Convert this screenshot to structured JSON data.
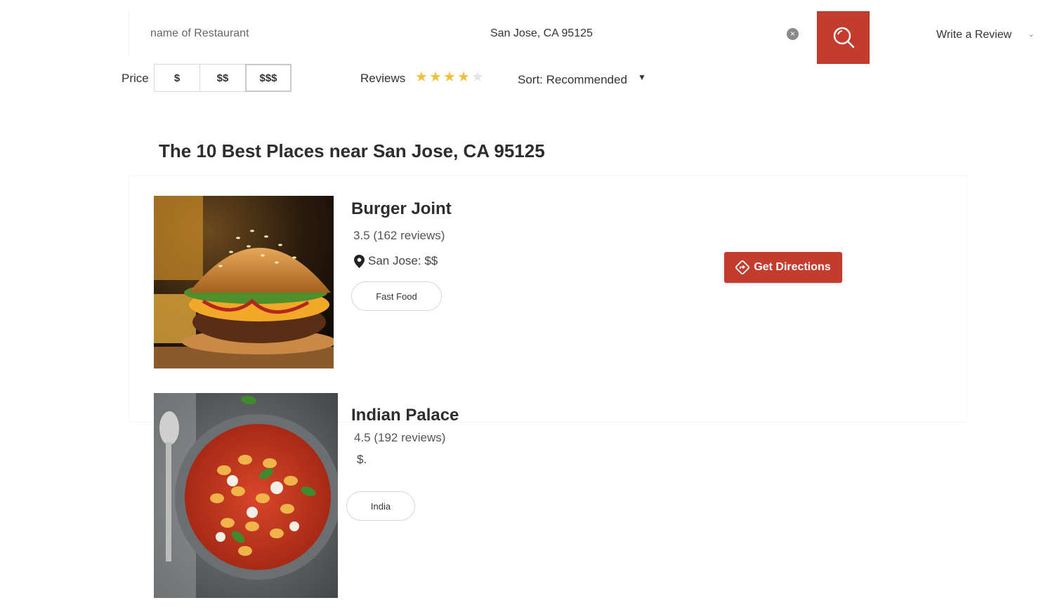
{
  "search": {
    "name_placeholder": "name of Restaurant",
    "location_value": "San Jose, CA 95125",
    "clear_icon": "close-icon",
    "search_icon": "search-icon"
  },
  "header": {
    "write_review": "Write a Review"
  },
  "filters": {
    "price_label": "Price",
    "price_options": [
      "$",
      "$$",
      "$$$"
    ],
    "reviews_label": "Reviews",
    "star_rating": 4,
    "star_max": 5,
    "sort_label": "Sort: Recommended"
  },
  "page_title": "The 10 Best Places near San Jose, CA 95125",
  "results": [
    {
      "name": "Burger Joint",
      "rating": "3.5 (162 reviews)",
      "location": "San Jose: $$",
      "tag": "Fast Food",
      "image": "burger-photo",
      "directions_label": "Get Directions"
    },
    {
      "name": "Indian Palace",
      "rating": "4.5 (192 reviews)",
      "location": "$.",
      "tag": "India",
      "image": "gnocchi-pan-photo"
    }
  ],
  "colors": {
    "accent": "#c43c2e",
    "star": "#f0bf3e",
    "star_off": "#e4e4e4"
  }
}
